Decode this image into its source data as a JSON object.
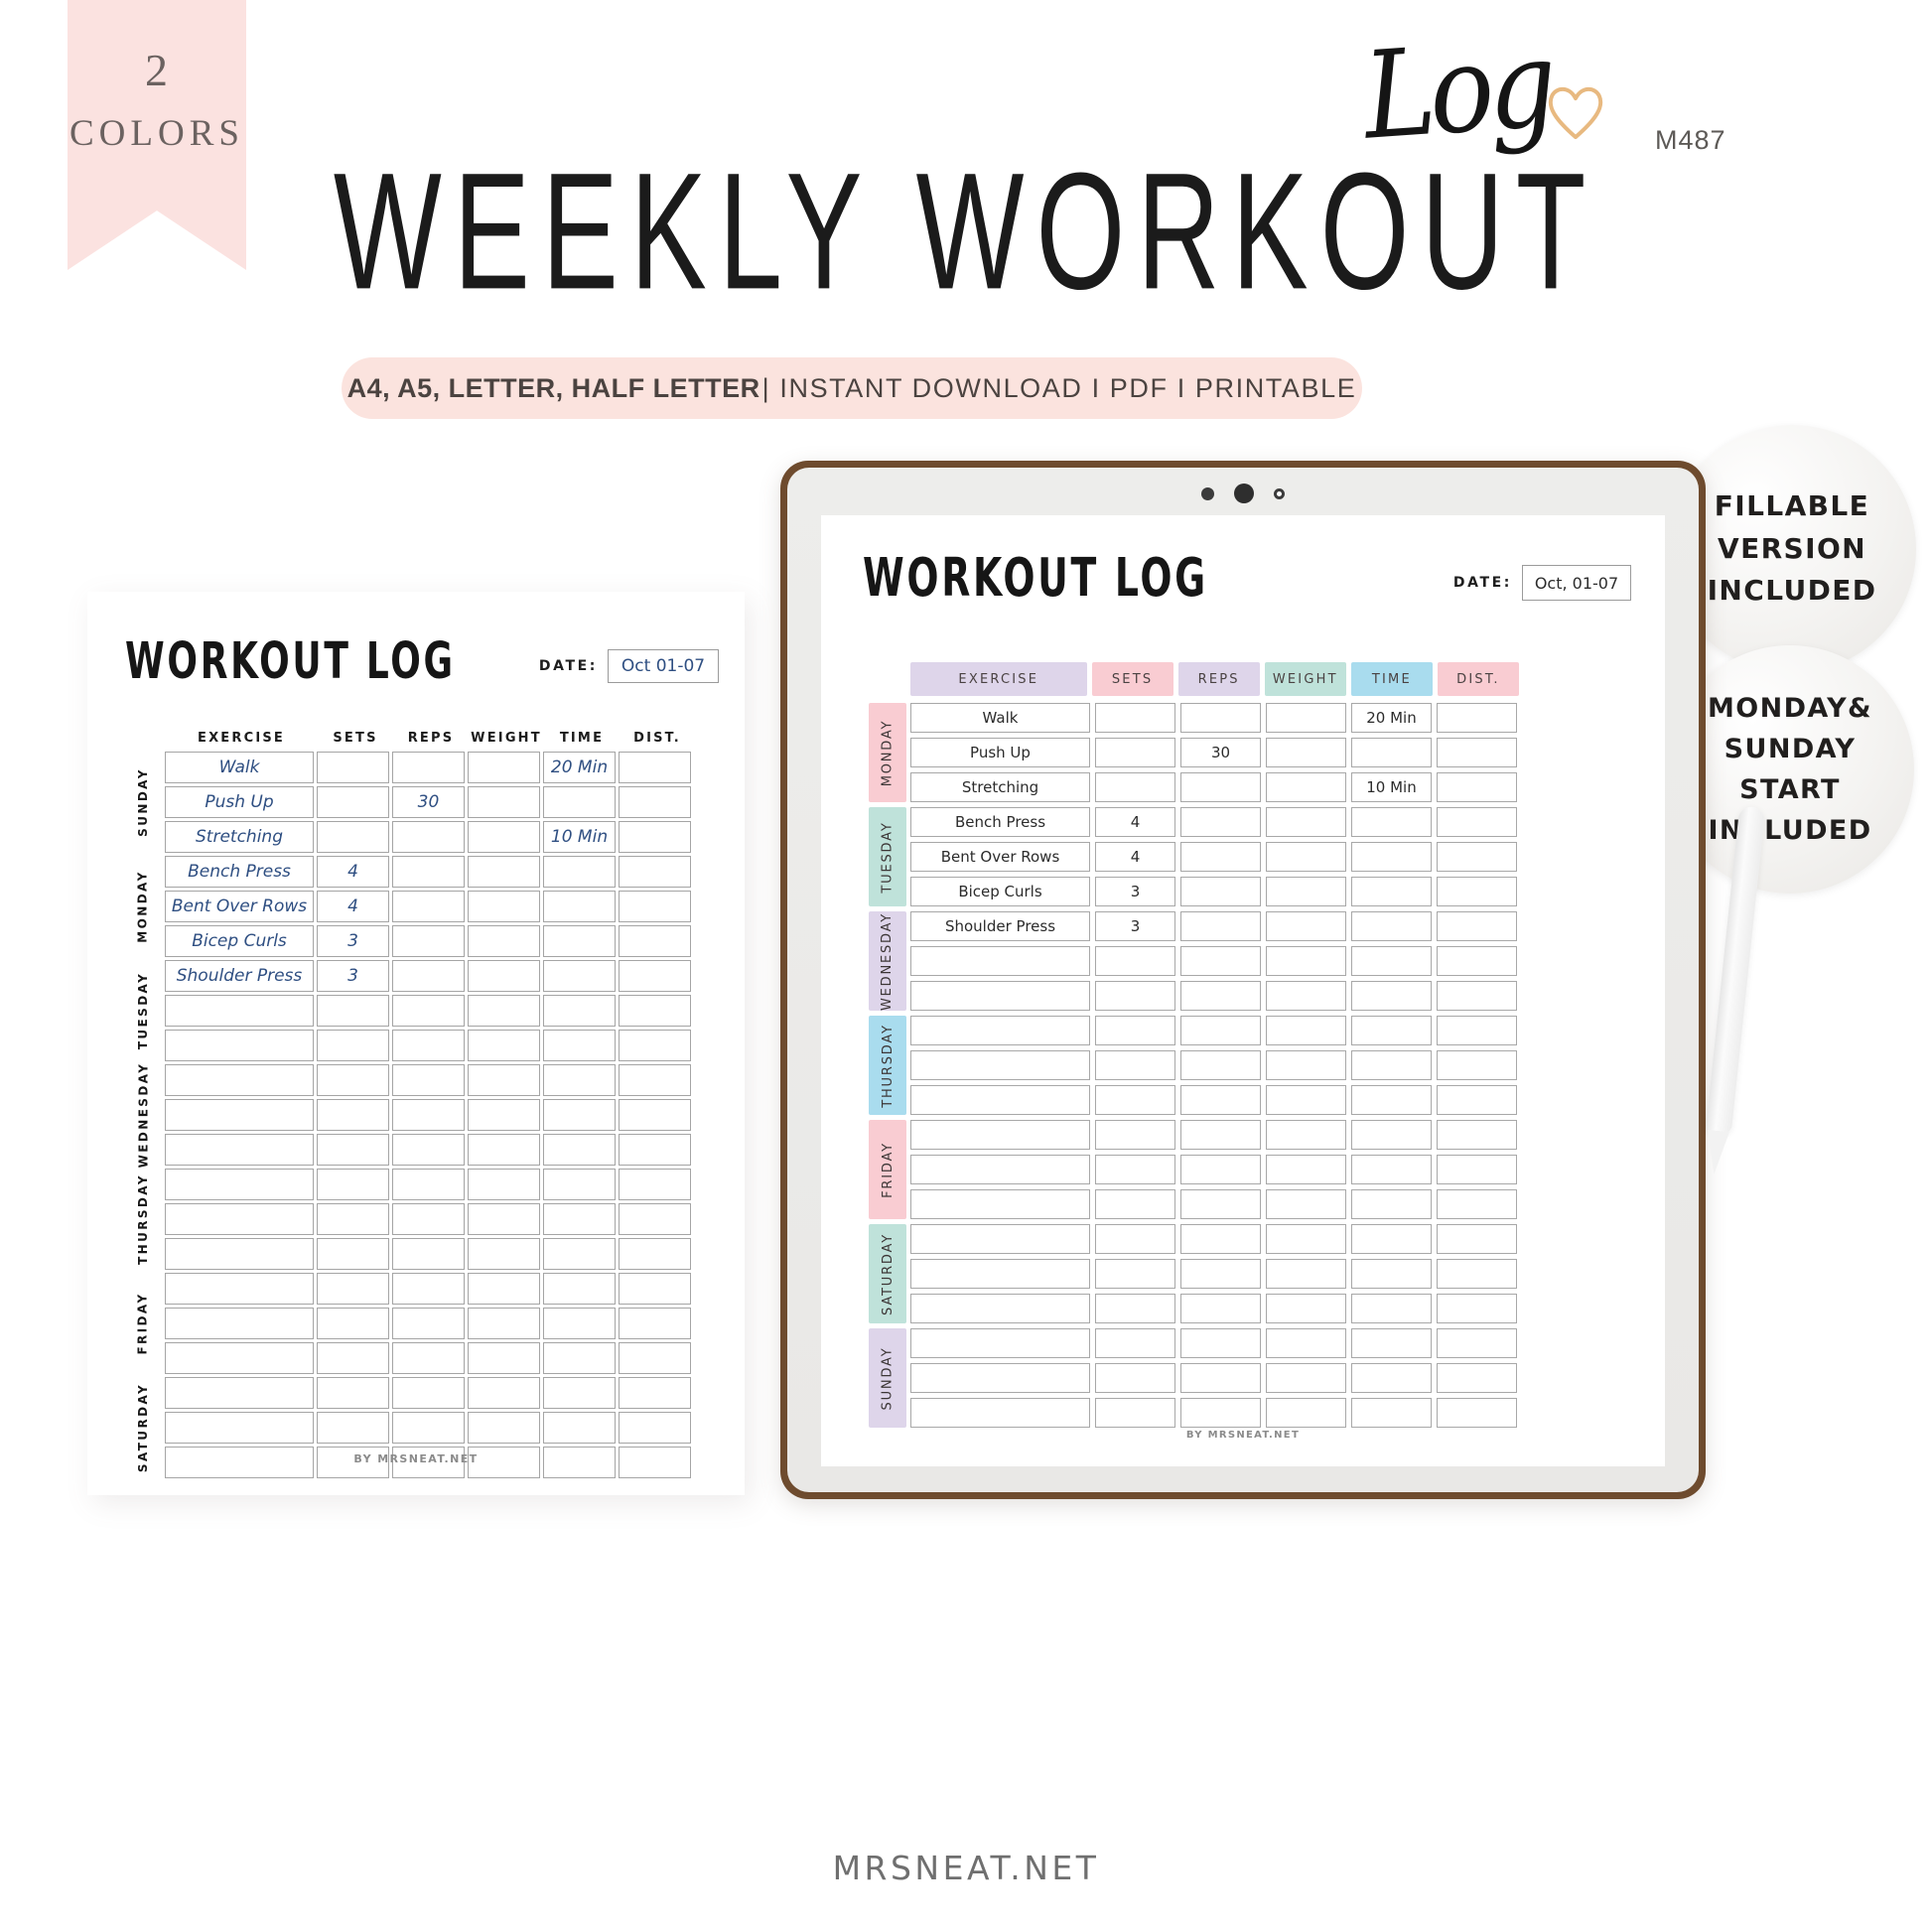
{
  "ribbon": {
    "number": "2",
    "label": "COLORS"
  },
  "header": {
    "title_main": "WEEKLY WORKOUT",
    "title_script": "Log",
    "product_code": "M487",
    "heart_color": "#e8b980"
  },
  "format_bar": {
    "formats": "A4, A5, LETTER, HALF LETTER",
    "rest": "| INSTANT DOWNLOAD I PDF I PRINTABLE",
    "background": "#fbe3de"
  },
  "badges": [
    {
      "id": "fillable",
      "lines": [
        "FILLABLE",
        "VERSION",
        "INCLUDED"
      ]
    },
    {
      "id": "start",
      "lines": [
        "MONDAY&",
        "SUNDAY",
        "START",
        "INCLUDED"
      ]
    }
  ],
  "printable": {
    "title": "WORKOUT LOG",
    "date_label": "DATE:",
    "date_value": "Oct 01-07",
    "columns": [
      "EXERCISE",
      "SETS",
      "REPS",
      "WEIGHT",
      "TIME",
      "DIST."
    ],
    "ink_color": "#2f4f82",
    "days": [
      {
        "name": "SUNDAY",
        "rows": [
          {
            "exercise": "Walk",
            "sets": "",
            "reps": "",
            "weight": "",
            "time": "20 Min",
            "dist": ""
          },
          {
            "exercise": "Push Up",
            "sets": "",
            "reps": "30",
            "weight": "",
            "time": "",
            "dist": ""
          },
          {
            "exercise": "Stretching",
            "sets": "",
            "reps": "",
            "weight": "",
            "time": "10 Min",
            "dist": ""
          }
        ]
      },
      {
        "name": "MONDAY",
        "rows": [
          {
            "exercise": "Bench Press",
            "sets": "4",
            "reps": "",
            "weight": "",
            "time": "",
            "dist": ""
          },
          {
            "exercise": "Bent Over Rows",
            "sets": "4",
            "reps": "",
            "weight": "",
            "time": "",
            "dist": ""
          },
          {
            "exercise": "Bicep Curls",
            "sets": "3",
            "reps": "",
            "weight": "",
            "time": "",
            "dist": ""
          }
        ]
      },
      {
        "name": "TUESDAY",
        "rows": [
          {
            "exercise": "Shoulder Press",
            "sets": "3",
            "reps": "",
            "weight": "",
            "time": "",
            "dist": ""
          },
          {
            "exercise": "",
            "sets": "",
            "reps": "",
            "weight": "",
            "time": "",
            "dist": ""
          },
          {
            "exercise": "",
            "sets": "",
            "reps": "",
            "weight": "",
            "time": "",
            "dist": ""
          }
        ]
      },
      {
        "name": "WEDNESDAY",
        "rows": [
          {
            "exercise": "",
            "sets": "",
            "reps": "",
            "weight": "",
            "time": "",
            "dist": ""
          },
          {
            "exercise": "",
            "sets": "",
            "reps": "",
            "weight": "",
            "time": "",
            "dist": ""
          },
          {
            "exercise": "",
            "sets": "",
            "reps": "",
            "weight": "",
            "time": "",
            "dist": ""
          }
        ]
      },
      {
        "name": "THURSDAY",
        "rows": [
          {
            "exercise": "",
            "sets": "",
            "reps": "",
            "weight": "",
            "time": "",
            "dist": ""
          },
          {
            "exercise": "",
            "sets": "",
            "reps": "",
            "weight": "",
            "time": "",
            "dist": ""
          },
          {
            "exercise": "",
            "sets": "",
            "reps": "",
            "weight": "",
            "time": "",
            "dist": ""
          }
        ]
      },
      {
        "name": "FRIDAY",
        "rows": [
          {
            "exercise": "",
            "sets": "",
            "reps": "",
            "weight": "",
            "time": "",
            "dist": ""
          },
          {
            "exercise": "",
            "sets": "",
            "reps": "",
            "weight": "",
            "time": "",
            "dist": ""
          },
          {
            "exercise": "",
            "sets": "",
            "reps": "",
            "weight": "",
            "time": "",
            "dist": ""
          }
        ]
      },
      {
        "name": "SATURDAY",
        "rows": [
          {
            "exercise": "",
            "sets": "",
            "reps": "",
            "weight": "",
            "time": "",
            "dist": ""
          },
          {
            "exercise": "",
            "sets": "",
            "reps": "",
            "weight": "",
            "time": "",
            "dist": ""
          },
          {
            "exercise": "",
            "sets": "",
            "reps": "",
            "weight": "",
            "time": "",
            "dist": ""
          }
        ]
      }
    ],
    "footer": "BY MRSNEAT.NET"
  },
  "tablet": {
    "title": "WORKOUT LOG",
    "date_label": "DATE:",
    "date_value": "Oct, 01-07",
    "column_headers": [
      {
        "label": "EXERCISE",
        "color": "#ded5ea"
      },
      {
        "label": "SETS",
        "color": "#f9ccd2"
      },
      {
        "label": "REPS",
        "color": "#ded5ea"
      },
      {
        "label": "WEIGHT",
        "color": "#bfe2da"
      },
      {
        "label": "TIME",
        "color": "#a9dcee"
      },
      {
        "label": "DIST.",
        "color": "#f9ccd2"
      }
    ],
    "days": [
      {
        "name": "MONDAY",
        "color": "#f9ccd2",
        "rows": [
          {
            "exercise": "Walk",
            "sets": "",
            "reps": "",
            "weight": "",
            "time": "20 Min",
            "dist": ""
          },
          {
            "exercise": "Push Up",
            "sets": "",
            "reps": "30",
            "weight": "",
            "time": "",
            "dist": ""
          },
          {
            "exercise": "Stretching",
            "sets": "",
            "reps": "",
            "weight": "",
            "time": "10 Min",
            "dist": ""
          }
        ]
      },
      {
        "name": "TUESDAY",
        "color": "#bfe2da",
        "rows": [
          {
            "exercise": "Bench Press",
            "sets": "4",
            "reps": "",
            "weight": "",
            "time": "",
            "dist": ""
          },
          {
            "exercise": "Bent Over Rows",
            "sets": "4",
            "reps": "",
            "weight": "",
            "time": "",
            "dist": ""
          },
          {
            "exercise": "Bicep Curls",
            "sets": "3",
            "reps": "",
            "weight": "",
            "time": "",
            "dist": ""
          }
        ]
      },
      {
        "name": "WEDNESDAY",
        "color": "#ded5ea",
        "rows": [
          {
            "exercise": "Shoulder Press",
            "sets": "3",
            "reps": "",
            "weight": "",
            "time": "",
            "dist": ""
          },
          {
            "exercise": "",
            "sets": "",
            "reps": "",
            "weight": "",
            "time": "",
            "dist": ""
          },
          {
            "exercise": "",
            "sets": "",
            "reps": "",
            "weight": "",
            "time": "",
            "dist": ""
          }
        ]
      },
      {
        "name": "THURSDAY",
        "color": "#a9dcee",
        "rows": [
          {
            "exercise": "",
            "sets": "",
            "reps": "",
            "weight": "",
            "time": "",
            "dist": ""
          },
          {
            "exercise": "",
            "sets": "",
            "reps": "",
            "weight": "",
            "time": "",
            "dist": ""
          },
          {
            "exercise": "",
            "sets": "",
            "reps": "",
            "weight": "",
            "time": "",
            "dist": ""
          }
        ]
      },
      {
        "name": "FRIDAY",
        "color": "#f9ccd2",
        "rows": [
          {
            "exercise": "",
            "sets": "",
            "reps": "",
            "weight": "",
            "time": "",
            "dist": ""
          },
          {
            "exercise": "",
            "sets": "",
            "reps": "",
            "weight": "",
            "time": "",
            "dist": ""
          },
          {
            "exercise": "",
            "sets": "",
            "reps": "",
            "weight": "",
            "time": "",
            "dist": ""
          }
        ]
      },
      {
        "name": "SATURDAY",
        "color": "#bfe2da",
        "rows": [
          {
            "exercise": "",
            "sets": "",
            "reps": "",
            "weight": "",
            "time": "",
            "dist": ""
          },
          {
            "exercise": "",
            "sets": "",
            "reps": "",
            "weight": "",
            "time": "",
            "dist": ""
          },
          {
            "exercise": "",
            "sets": "",
            "reps": "",
            "weight": "",
            "time": "",
            "dist": ""
          }
        ]
      },
      {
        "name": "SUNDAY",
        "color": "#ded5ea",
        "rows": [
          {
            "exercise": "",
            "sets": "",
            "reps": "",
            "weight": "",
            "time": "",
            "dist": ""
          },
          {
            "exercise": "",
            "sets": "",
            "reps": "",
            "weight": "",
            "time": "",
            "dist": ""
          },
          {
            "exercise": "",
            "sets": "",
            "reps": "",
            "weight": "",
            "time": "",
            "dist": ""
          }
        ]
      }
    ],
    "footer": "BY MRSNEAT.NET"
  },
  "watermark": "MRSNEAT.NET"
}
